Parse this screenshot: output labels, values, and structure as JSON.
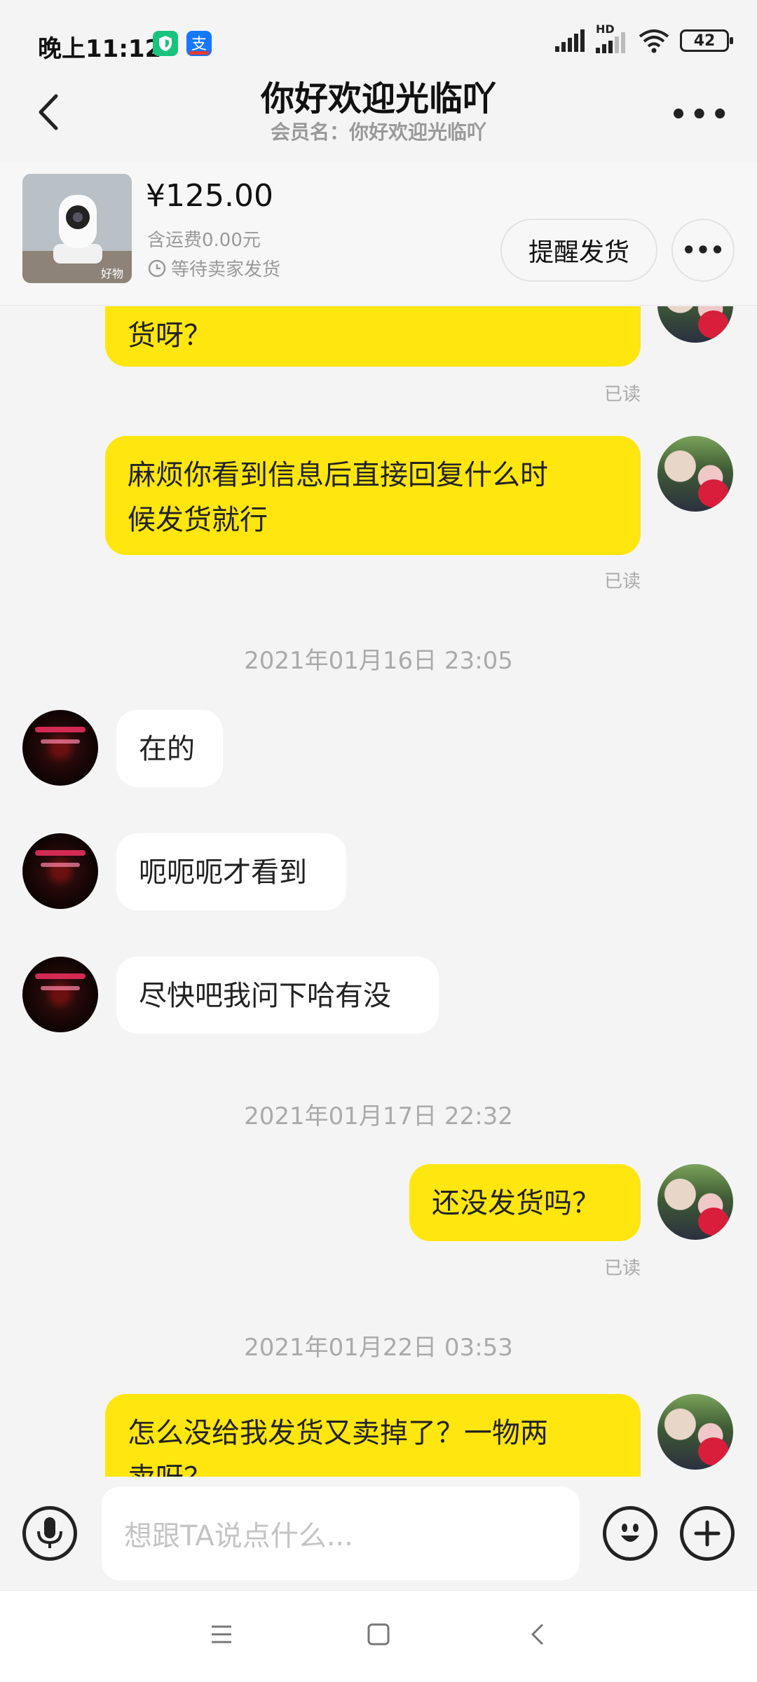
{
  "status_bar": {
    "time": "晚上11:12",
    "battery": "42",
    "network": "HD",
    "app_icons": [
      "shield-app-icon",
      "alipay-icon"
    ]
  },
  "header": {
    "title": "你好欢迎光临吖",
    "subtitle": "会员名：你好欢迎光临吖",
    "more_icon": "more-icon"
  },
  "product": {
    "price": "¥125.00",
    "shipping": "含运费0.00元",
    "status": "等待卖家发货",
    "remind_button": "提醒发货",
    "more_button": "•••"
  },
  "messages": [
    {
      "side": "me",
      "text": "货呀？",
      "read": "已读"
    },
    {
      "side": "me",
      "text_line1": "麻烦你看到信息后直接回复什么时",
      "text_line2": "候发货就行",
      "read": "已读"
    },
    {
      "timestamp": "2021年01月16日 23:05"
    },
    {
      "side": "them",
      "text": "在的"
    },
    {
      "side": "them",
      "text": "呃呃呃才看到"
    },
    {
      "side": "them",
      "text": "尽快吧我问下哈有没"
    },
    {
      "timestamp": "2021年01月17日 22:32"
    },
    {
      "side": "me",
      "text": "还没发货吗？",
      "read": "已读"
    },
    {
      "timestamp": "2021年01月22日 03:53"
    },
    {
      "side": "me",
      "text_line1": "怎么没给我发货又卖掉了？一物两",
      "text_line2": "卖呀？"
    }
  ],
  "input_bar": {
    "placeholder": "想跟TA说点什么...",
    "voice_icon": "microphone-icon",
    "emoji_icon": "emoji-icon",
    "plus_icon": "plus-icon"
  },
  "nav_bar": {
    "icons": [
      "menu-icon",
      "home-icon",
      "back-icon"
    ]
  },
  "colors": {
    "my_bubble": "#ffe60f",
    "their_bubble": "#ffffff",
    "background": "#f4f4f4"
  }
}
